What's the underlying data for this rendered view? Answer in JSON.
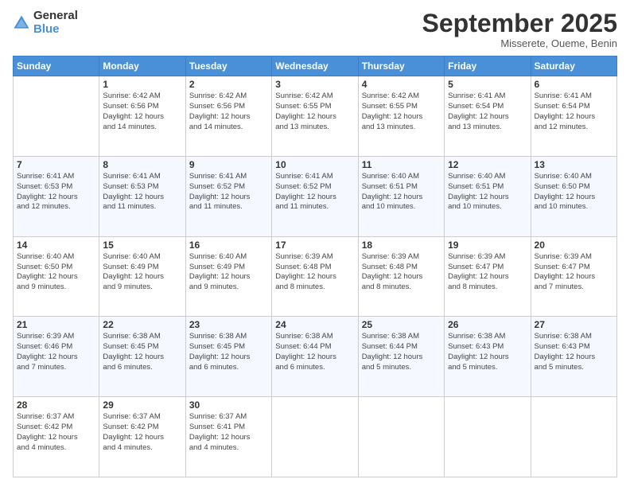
{
  "logo": {
    "general": "General",
    "blue": "Blue"
  },
  "title": "September 2025",
  "subtitle": "Misserete, Oueme, Benin",
  "days_header": [
    "Sunday",
    "Monday",
    "Tuesday",
    "Wednesday",
    "Thursday",
    "Friday",
    "Saturday"
  ],
  "weeks": [
    [
      {
        "num": "",
        "info": ""
      },
      {
        "num": "1",
        "info": "Sunrise: 6:42 AM\nSunset: 6:56 PM\nDaylight: 12 hours\nand 14 minutes."
      },
      {
        "num": "2",
        "info": "Sunrise: 6:42 AM\nSunset: 6:56 PM\nDaylight: 12 hours\nand 14 minutes."
      },
      {
        "num": "3",
        "info": "Sunrise: 6:42 AM\nSunset: 6:55 PM\nDaylight: 12 hours\nand 13 minutes."
      },
      {
        "num": "4",
        "info": "Sunrise: 6:42 AM\nSunset: 6:55 PM\nDaylight: 12 hours\nand 13 minutes."
      },
      {
        "num": "5",
        "info": "Sunrise: 6:41 AM\nSunset: 6:54 PM\nDaylight: 12 hours\nand 13 minutes."
      },
      {
        "num": "6",
        "info": "Sunrise: 6:41 AM\nSunset: 6:54 PM\nDaylight: 12 hours\nand 12 minutes."
      }
    ],
    [
      {
        "num": "7",
        "info": "Sunrise: 6:41 AM\nSunset: 6:53 PM\nDaylight: 12 hours\nand 12 minutes."
      },
      {
        "num": "8",
        "info": "Sunrise: 6:41 AM\nSunset: 6:53 PM\nDaylight: 12 hours\nand 11 minutes."
      },
      {
        "num": "9",
        "info": "Sunrise: 6:41 AM\nSunset: 6:52 PM\nDaylight: 12 hours\nand 11 minutes."
      },
      {
        "num": "10",
        "info": "Sunrise: 6:41 AM\nSunset: 6:52 PM\nDaylight: 12 hours\nand 11 minutes."
      },
      {
        "num": "11",
        "info": "Sunrise: 6:40 AM\nSunset: 6:51 PM\nDaylight: 12 hours\nand 10 minutes."
      },
      {
        "num": "12",
        "info": "Sunrise: 6:40 AM\nSunset: 6:51 PM\nDaylight: 12 hours\nand 10 minutes."
      },
      {
        "num": "13",
        "info": "Sunrise: 6:40 AM\nSunset: 6:50 PM\nDaylight: 12 hours\nand 10 minutes."
      }
    ],
    [
      {
        "num": "14",
        "info": "Sunrise: 6:40 AM\nSunset: 6:50 PM\nDaylight: 12 hours\nand 9 minutes."
      },
      {
        "num": "15",
        "info": "Sunrise: 6:40 AM\nSunset: 6:49 PM\nDaylight: 12 hours\nand 9 minutes."
      },
      {
        "num": "16",
        "info": "Sunrise: 6:40 AM\nSunset: 6:49 PM\nDaylight: 12 hours\nand 9 minutes."
      },
      {
        "num": "17",
        "info": "Sunrise: 6:39 AM\nSunset: 6:48 PM\nDaylight: 12 hours\nand 8 minutes."
      },
      {
        "num": "18",
        "info": "Sunrise: 6:39 AM\nSunset: 6:48 PM\nDaylight: 12 hours\nand 8 minutes."
      },
      {
        "num": "19",
        "info": "Sunrise: 6:39 AM\nSunset: 6:47 PM\nDaylight: 12 hours\nand 8 minutes."
      },
      {
        "num": "20",
        "info": "Sunrise: 6:39 AM\nSunset: 6:47 PM\nDaylight: 12 hours\nand 7 minutes."
      }
    ],
    [
      {
        "num": "21",
        "info": "Sunrise: 6:39 AM\nSunset: 6:46 PM\nDaylight: 12 hours\nand 7 minutes."
      },
      {
        "num": "22",
        "info": "Sunrise: 6:38 AM\nSunset: 6:45 PM\nDaylight: 12 hours\nand 6 minutes."
      },
      {
        "num": "23",
        "info": "Sunrise: 6:38 AM\nSunset: 6:45 PM\nDaylight: 12 hours\nand 6 minutes."
      },
      {
        "num": "24",
        "info": "Sunrise: 6:38 AM\nSunset: 6:44 PM\nDaylight: 12 hours\nand 6 minutes."
      },
      {
        "num": "25",
        "info": "Sunrise: 6:38 AM\nSunset: 6:44 PM\nDaylight: 12 hours\nand 5 minutes."
      },
      {
        "num": "26",
        "info": "Sunrise: 6:38 AM\nSunset: 6:43 PM\nDaylight: 12 hours\nand 5 minutes."
      },
      {
        "num": "27",
        "info": "Sunrise: 6:38 AM\nSunset: 6:43 PM\nDaylight: 12 hours\nand 5 minutes."
      }
    ],
    [
      {
        "num": "28",
        "info": "Sunrise: 6:37 AM\nSunset: 6:42 PM\nDaylight: 12 hours\nand 4 minutes."
      },
      {
        "num": "29",
        "info": "Sunrise: 6:37 AM\nSunset: 6:42 PM\nDaylight: 12 hours\nand 4 minutes."
      },
      {
        "num": "30",
        "info": "Sunrise: 6:37 AM\nSunset: 6:41 PM\nDaylight: 12 hours\nand 4 minutes."
      },
      {
        "num": "",
        "info": ""
      },
      {
        "num": "",
        "info": ""
      },
      {
        "num": "",
        "info": ""
      },
      {
        "num": "",
        "info": ""
      }
    ]
  ]
}
